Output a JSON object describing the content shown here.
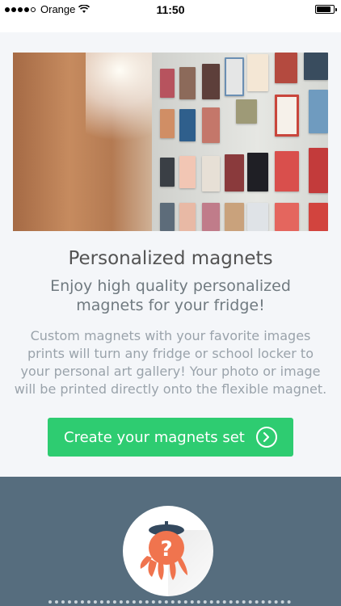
{
  "status_bar": {
    "carrier": "Orange",
    "time": "11:50",
    "signal_bars": 4,
    "battery_level": 0.85
  },
  "hero": {
    "image_alt_icon": "magnet-fridge-photo"
  },
  "content": {
    "title": "Personalized magnets",
    "subtitle": "Enjoy high quality personalized magnets for your fridge!",
    "description": "Custom magnets with your favorite images prints will turn any fridge or school locker to your personal art gallery! Your photo or image will be printed directly onto the flexible magnet."
  },
  "cta": {
    "label": "Create your magnets set",
    "icon": "chevron-right-circle-icon",
    "color": "#2ecc71"
  },
  "footer": {
    "mascot_icon": "octopus-question-icon",
    "background_color": "#566d7e"
  }
}
